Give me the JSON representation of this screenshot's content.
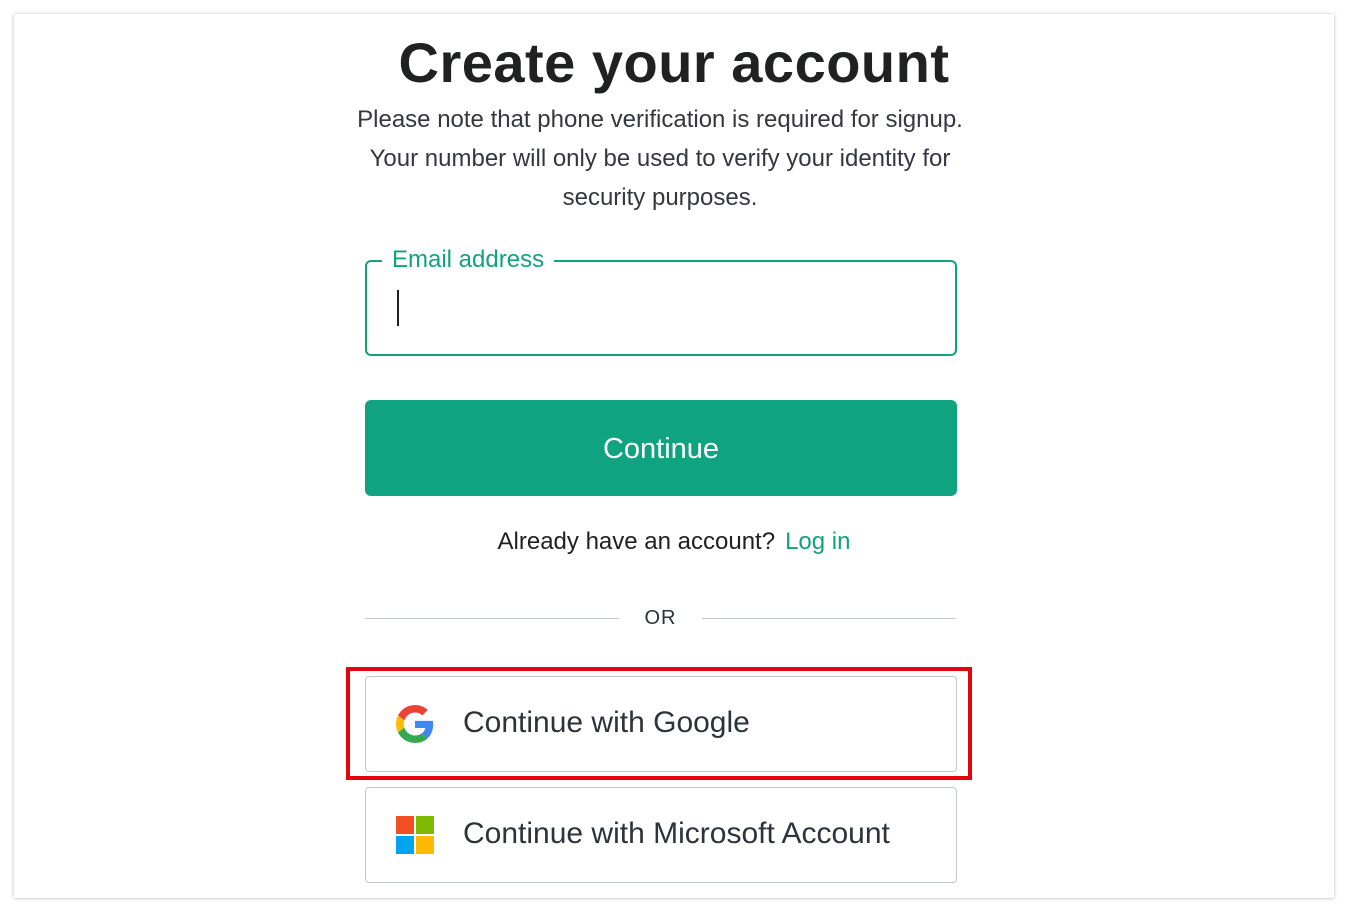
{
  "page": {
    "title": "Create your account",
    "note": "Please note that phone verification is required for signup. Your number will only be used to verify your identity for security purposes."
  },
  "email": {
    "label": "Email address",
    "value": "",
    "placeholder": ""
  },
  "continue_button": {
    "label": "Continue"
  },
  "login": {
    "prompt": "Already have an account?",
    "link_label": "Log in"
  },
  "divider": {
    "label": "OR"
  },
  "social": {
    "google": {
      "label": "Continue with Google",
      "icon": "google-icon"
    },
    "microsoft": {
      "label": "Continue with Microsoft Account",
      "icon": "microsoft-icon"
    }
  },
  "colors": {
    "accent": "#10a37f",
    "title": "#202123",
    "highlight": "#e2050e",
    "border": "#c2c8d0"
  }
}
